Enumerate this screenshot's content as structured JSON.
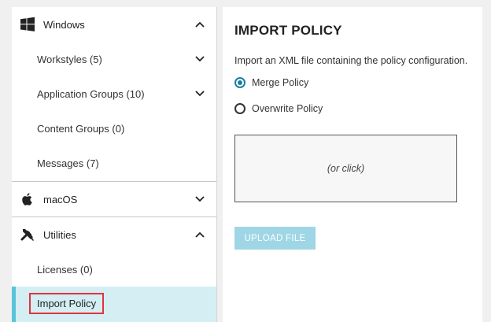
{
  "sidebar": {
    "windows": {
      "label": "Windows",
      "icon": "windows-logo-icon"
    },
    "items_windows": [
      {
        "label": "Workstyles (5)"
      },
      {
        "label": "Application Groups (10)"
      },
      {
        "label": "Content Groups (0)"
      },
      {
        "label": "Messages (7)"
      }
    ],
    "macos": {
      "label": "macOS",
      "icon": "apple-logo-icon"
    },
    "utilities": {
      "label": "Utilities",
      "icon": "tools-icon"
    },
    "items_utilities": [
      {
        "label": "Licenses (0)"
      },
      {
        "label": "Import Policy"
      }
    ]
  },
  "main": {
    "title": "IMPORT POLICY",
    "description": "Import an XML file containing the policy configuration.",
    "options": [
      {
        "label": "Merge Policy",
        "checked": true
      },
      {
        "label": "Overwrite Policy",
        "checked": false
      }
    ],
    "dropzone_text": "(or click)",
    "upload_label": "UPLOAD FILE"
  },
  "colors": {
    "accent": "#57c4d9",
    "active_bg": "#d4eef4",
    "highlight_border": "#e0343f",
    "radio_checked": "#1a7fa0",
    "upload_button": "#9fd6e6"
  }
}
